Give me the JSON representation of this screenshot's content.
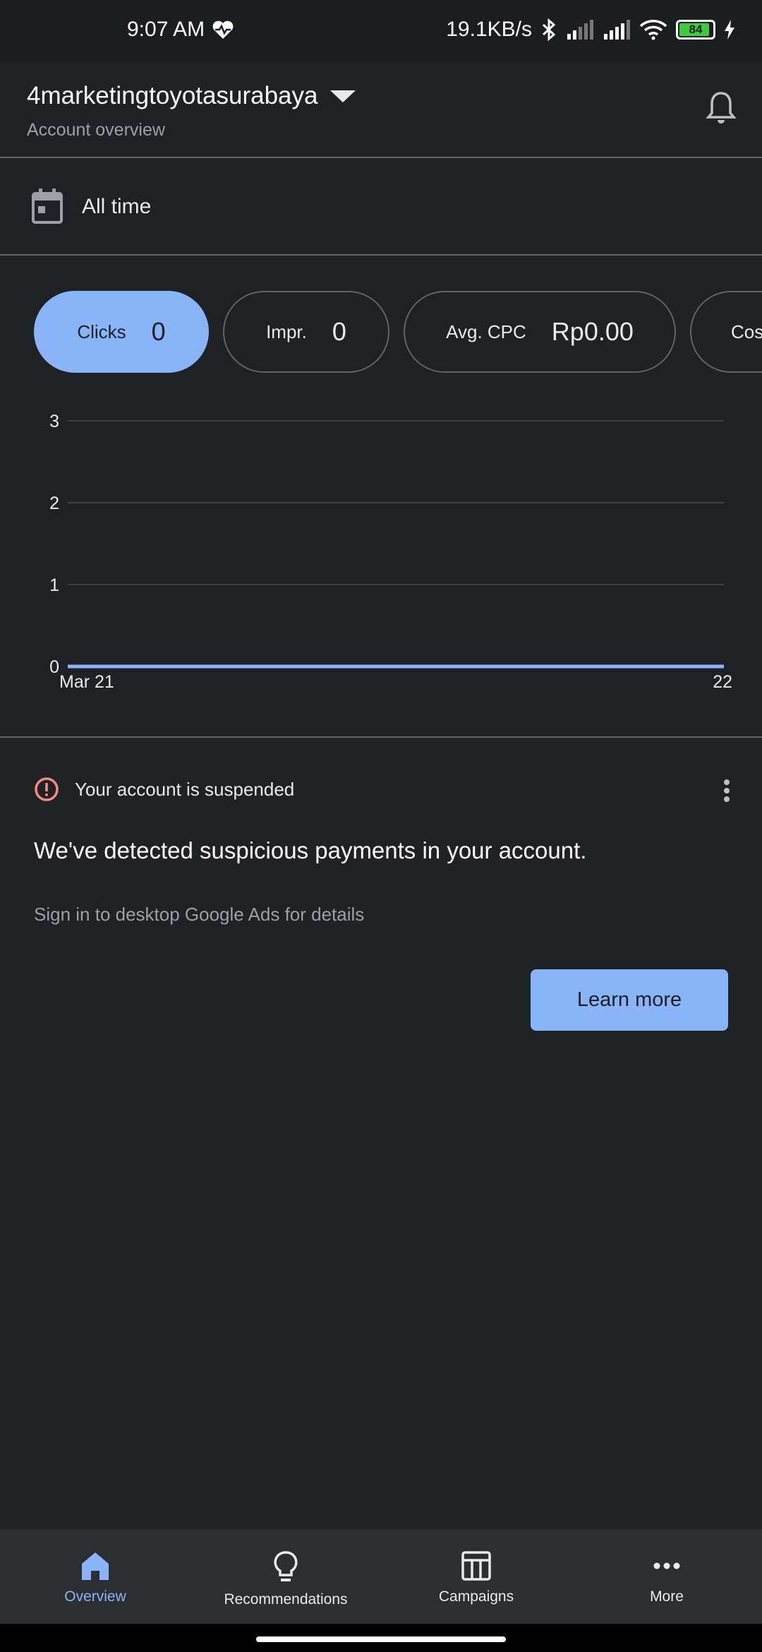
{
  "status_bar": {
    "time": "9:07 AM",
    "network_speed": "19.1KB/s",
    "battery_level": "84",
    "icons": [
      "heart-pulse-icon",
      "bluetooth-icon",
      "signal-icon",
      "signal-icon",
      "wifi-icon",
      "battery-icon",
      "charging-icon"
    ]
  },
  "header": {
    "account_name": "4marketingtoyotasurabaya",
    "subtitle": "Account overview",
    "icons": [
      "dropdown-arrow-icon",
      "bell-icon"
    ]
  },
  "date_range": {
    "label": "All time",
    "icon": "calendar-icon"
  },
  "metrics": [
    {
      "label": "Clicks",
      "value": "0",
      "active": true
    },
    {
      "label": "Impr.",
      "value": "0",
      "active": false
    },
    {
      "label": "Avg. CPC",
      "value": "Rp0.00",
      "active": false
    },
    {
      "label": "Cost",
      "value": "",
      "active": false
    }
  ],
  "chart_data": {
    "type": "line",
    "x_tick_labels": [
      "Mar 21",
      "22"
    ],
    "y_ticks": [
      "0",
      "1",
      "2",
      "3"
    ],
    "ylim": [
      0,
      3
    ],
    "grid": true,
    "series": [
      {
        "values": [
          0,
          0
        ],
        "color": "#8ab4f8"
      }
    ]
  },
  "alert": {
    "status": "Your account is suspended",
    "headline": "We've detected suspicious payments in your account.",
    "details": "Sign in to desktop Google Ads for details",
    "button_label": "Learn more",
    "icons": [
      "alert-circle-icon",
      "more-vertical-icon"
    ]
  },
  "bottom_nav": {
    "items": [
      {
        "label": "Overview",
        "icon": "home-icon",
        "active": true
      },
      {
        "label": "Recommendations",
        "icon": "lightbulb-icon",
        "active": false
      },
      {
        "label": "Campaigns",
        "icon": "campaigns-icon",
        "active": false
      },
      {
        "label": "More",
        "icon": "more-horizontal-icon",
        "active": false
      }
    ]
  },
  "colors": {
    "background": "#202124",
    "accent": "#8ab4f8",
    "alert": "#f28b82",
    "nav_background": "#2d2e31"
  }
}
